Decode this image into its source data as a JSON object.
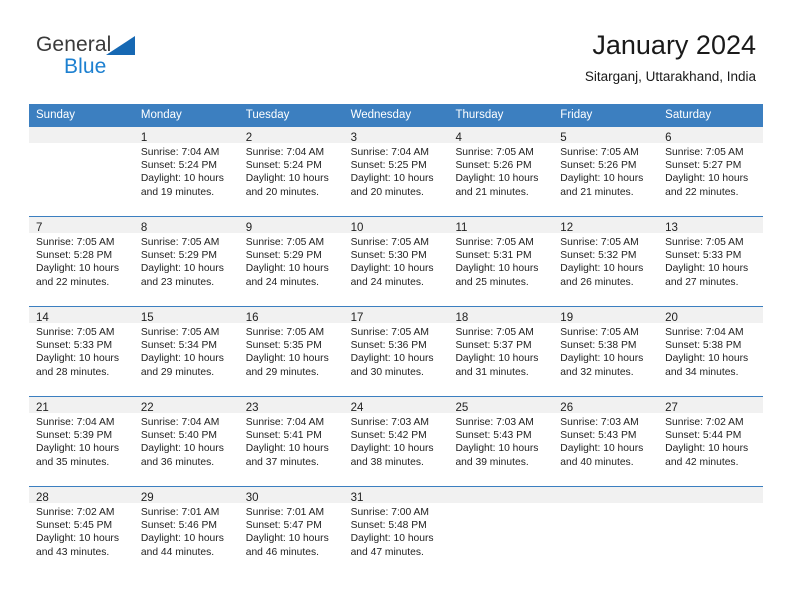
{
  "brand": {
    "name_top": "General",
    "name_bottom": "Blue",
    "triangle_color": "#1668b3",
    "text_color_bottom": "#1d80d0"
  },
  "header": {
    "title": "January 2024",
    "subtitle": "Sitarganj, Uttarakhand, India"
  },
  "theme": {
    "header_blue": "#3c7fc0",
    "daynum_band": "#f1f1f1",
    "text": "#222222"
  },
  "weekdays": [
    "Sunday",
    "Monday",
    "Tuesday",
    "Wednesday",
    "Thursday",
    "Friday",
    "Saturday"
  ],
  "weeks": [
    [
      {
        "day": "",
        "sunrise": "",
        "sunset": "",
        "daylight_1": "",
        "daylight_2": ""
      },
      {
        "day": "1",
        "sunrise": "Sunrise: 7:04 AM",
        "sunset": "Sunset: 5:24 PM",
        "daylight_1": "Daylight: 10 hours",
        "daylight_2": "and 19 minutes."
      },
      {
        "day": "2",
        "sunrise": "Sunrise: 7:04 AM",
        "sunset": "Sunset: 5:24 PM",
        "daylight_1": "Daylight: 10 hours",
        "daylight_2": "and 20 minutes."
      },
      {
        "day": "3",
        "sunrise": "Sunrise: 7:04 AM",
        "sunset": "Sunset: 5:25 PM",
        "daylight_1": "Daylight: 10 hours",
        "daylight_2": "and 20 minutes."
      },
      {
        "day": "4",
        "sunrise": "Sunrise: 7:05 AM",
        "sunset": "Sunset: 5:26 PM",
        "daylight_1": "Daylight: 10 hours",
        "daylight_2": "and 21 minutes."
      },
      {
        "day": "5",
        "sunrise": "Sunrise: 7:05 AM",
        "sunset": "Sunset: 5:26 PM",
        "daylight_1": "Daylight: 10 hours",
        "daylight_2": "and 21 minutes."
      },
      {
        "day": "6",
        "sunrise": "Sunrise: 7:05 AM",
        "sunset": "Sunset: 5:27 PM",
        "daylight_1": "Daylight: 10 hours",
        "daylight_2": "and 22 minutes."
      }
    ],
    [
      {
        "day": "7",
        "sunrise": "Sunrise: 7:05 AM",
        "sunset": "Sunset: 5:28 PM",
        "daylight_1": "Daylight: 10 hours",
        "daylight_2": "and 22 minutes."
      },
      {
        "day": "8",
        "sunrise": "Sunrise: 7:05 AM",
        "sunset": "Sunset: 5:29 PM",
        "daylight_1": "Daylight: 10 hours",
        "daylight_2": "and 23 minutes."
      },
      {
        "day": "9",
        "sunrise": "Sunrise: 7:05 AM",
        "sunset": "Sunset: 5:29 PM",
        "daylight_1": "Daylight: 10 hours",
        "daylight_2": "and 24 minutes."
      },
      {
        "day": "10",
        "sunrise": "Sunrise: 7:05 AM",
        "sunset": "Sunset: 5:30 PM",
        "daylight_1": "Daylight: 10 hours",
        "daylight_2": "and 24 minutes."
      },
      {
        "day": "11",
        "sunrise": "Sunrise: 7:05 AM",
        "sunset": "Sunset: 5:31 PM",
        "daylight_1": "Daylight: 10 hours",
        "daylight_2": "and 25 minutes."
      },
      {
        "day": "12",
        "sunrise": "Sunrise: 7:05 AM",
        "sunset": "Sunset: 5:32 PM",
        "daylight_1": "Daylight: 10 hours",
        "daylight_2": "and 26 minutes."
      },
      {
        "day": "13",
        "sunrise": "Sunrise: 7:05 AM",
        "sunset": "Sunset: 5:33 PM",
        "daylight_1": "Daylight: 10 hours",
        "daylight_2": "and 27 minutes."
      }
    ],
    [
      {
        "day": "14",
        "sunrise": "Sunrise: 7:05 AM",
        "sunset": "Sunset: 5:33 PM",
        "daylight_1": "Daylight: 10 hours",
        "daylight_2": "and 28 minutes."
      },
      {
        "day": "15",
        "sunrise": "Sunrise: 7:05 AM",
        "sunset": "Sunset: 5:34 PM",
        "daylight_1": "Daylight: 10 hours",
        "daylight_2": "and 29 minutes."
      },
      {
        "day": "16",
        "sunrise": "Sunrise: 7:05 AM",
        "sunset": "Sunset: 5:35 PM",
        "daylight_1": "Daylight: 10 hours",
        "daylight_2": "and 29 minutes."
      },
      {
        "day": "17",
        "sunrise": "Sunrise: 7:05 AM",
        "sunset": "Sunset: 5:36 PM",
        "daylight_1": "Daylight: 10 hours",
        "daylight_2": "and 30 minutes."
      },
      {
        "day": "18",
        "sunrise": "Sunrise: 7:05 AM",
        "sunset": "Sunset: 5:37 PM",
        "daylight_1": "Daylight: 10 hours",
        "daylight_2": "and 31 minutes."
      },
      {
        "day": "19",
        "sunrise": "Sunrise: 7:05 AM",
        "sunset": "Sunset: 5:38 PM",
        "daylight_1": "Daylight: 10 hours",
        "daylight_2": "and 32 minutes."
      },
      {
        "day": "20",
        "sunrise": "Sunrise: 7:04 AM",
        "sunset": "Sunset: 5:38 PM",
        "daylight_1": "Daylight: 10 hours",
        "daylight_2": "and 34 minutes."
      }
    ],
    [
      {
        "day": "21",
        "sunrise": "Sunrise: 7:04 AM",
        "sunset": "Sunset: 5:39 PM",
        "daylight_1": "Daylight: 10 hours",
        "daylight_2": "and 35 minutes."
      },
      {
        "day": "22",
        "sunrise": "Sunrise: 7:04 AM",
        "sunset": "Sunset: 5:40 PM",
        "daylight_1": "Daylight: 10 hours",
        "daylight_2": "and 36 minutes."
      },
      {
        "day": "23",
        "sunrise": "Sunrise: 7:04 AM",
        "sunset": "Sunset: 5:41 PM",
        "daylight_1": "Daylight: 10 hours",
        "daylight_2": "and 37 minutes."
      },
      {
        "day": "24",
        "sunrise": "Sunrise: 7:03 AM",
        "sunset": "Sunset: 5:42 PM",
        "daylight_1": "Daylight: 10 hours",
        "daylight_2": "and 38 minutes."
      },
      {
        "day": "25",
        "sunrise": "Sunrise: 7:03 AM",
        "sunset": "Sunset: 5:43 PM",
        "daylight_1": "Daylight: 10 hours",
        "daylight_2": "and 39 minutes."
      },
      {
        "day": "26",
        "sunrise": "Sunrise: 7:03 AM",
        "sunset": "Sunset: 5:43 PM",
        "daylight_1": "Daylight: 10 hours",
        "daylight_2": "and 40 minutes."
      },
      {
        "day": "27",
        "sunrise": "Sunrise: 7:02 AM",
        "sunset": "Sunset: 5:44 PM",
        "daylight_1": "Daylight: 10 hours",
        "daylight_2": "and 42 minutes."
      }
    ],
    [
      {
        "day": "28",
        "sunrise": "Sunrise: 7:02 AM",
        "sunset": "Sunset: 5:45 PM",
        "daylight_1": "Daylight: 10 hours",
        "daylight_2": "and 43 minutes."
      },
      {
        "day": "29",
        "sunrise": "Sunrise: 7:01 AM",
        "sunset": "Sunset: 5:46 PM",
        "daylight_1": "Daylight: 10 hours",
        "daylight_2": "and 44 minutes."
      },
      {
        "day": "30",
        "sunrise": "Sunrise: 7:01 AM",
        "sunset": "Sunset: 5:47 PM",
        "daylight_1": "Daylight: 10 hours",
        "daylight_2": "and 46 minutes."
      },
      {
        "day": "31",
        "sunrise": "Sunrise: 7:00 AM",
        "sunset": "Sunset: 5:48 PM",
        "daylight_1": "Daylight: 10 hours",
        "daylight_2": "and 47 minutes."
      },
      {
        "day": "",
        "sunrise": "",
        "sunset": "",
        "daylight_1": "",
        "daylight_2": ""
      },
      {
        "day": "",
        "sunrise": "",
        "sunset": "",
        "daylight_1": "",
        "daylight_2": ""
      },
      {
        "day": "",
        "sunrise": "",
        "sunset": "",
        "daylight_1": "",
        "daylight_2": ""
      }
    ]
  ]
}
